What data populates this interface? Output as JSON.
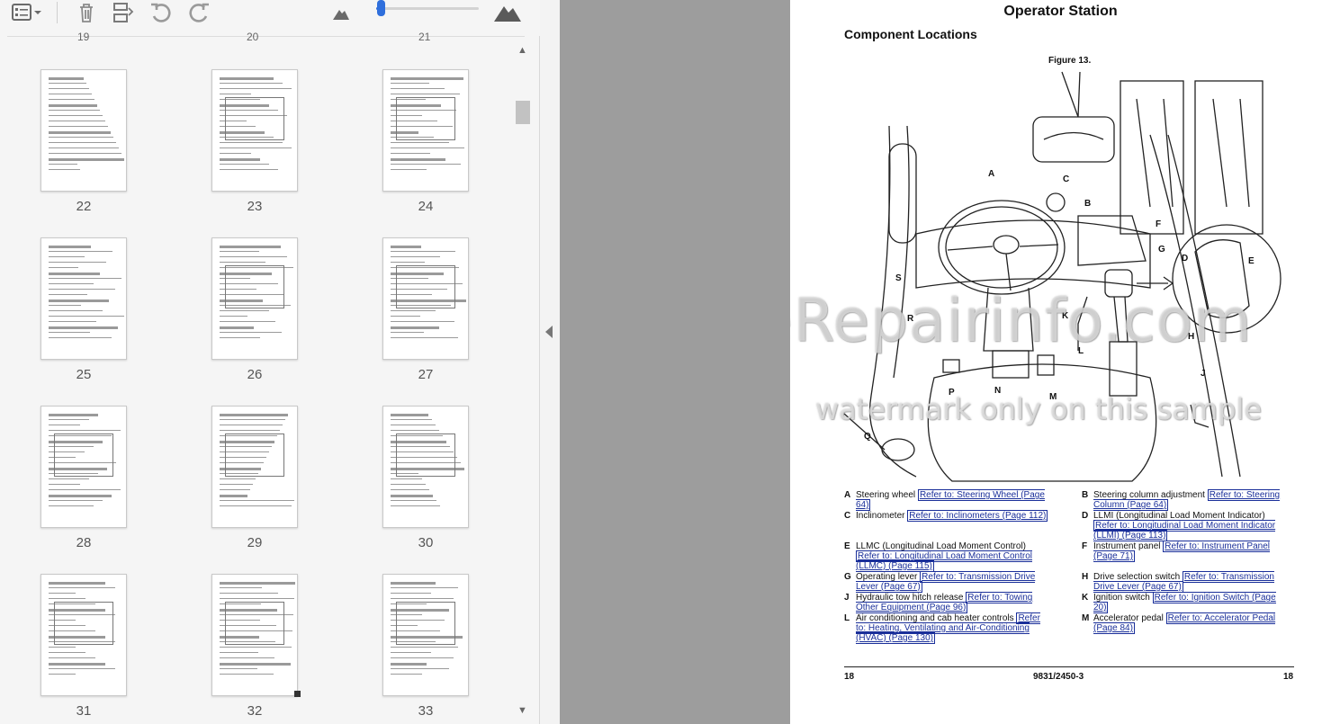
{
  "toolbar": {
    "buttons": [
      "thumbnail-view-menu",
      "delete",
      "replace-page",
      "rotate-counterclockwise",
      "rotate-clockwise",
      "zoom-out-thumbnails",
      "zoom-in-thumbnails"
    ],
    "zoom_level": 0.04,
    "accent_color": "#2f6fdc"
  },
  "thumbnails": {
    "partial_row_labels": [
      "19",
      "20",
      "21"
    ],
    "pages": [
      "22",
      "23",
      "24",
      "25",
      "26",
      "27",
      "28",
      "29",
      "30",
      "31",
      "32",
      "33"
    ]
  },
  "page": {
    "heading": "Operator Station",
    "subheading": "Component Locations",
    "figure_label": "Figure 13.",
    "callouts": [
      "A",
      "B",
      "C",
      "D",
      "E",
      "F",
      "G",
      "H",
      "J",
      "K",
      "L",
      "M",
      "N",
      "P",
      "Q",
      "R",
      "S"
    ],
    "legend": [
      {
        "key": "A",
        "text": "Steering wheel ",
        "link": "Refer to: Steering Wheel (Page 64)"
      },
      {
        "key": "B",
        "text": "Steering column adjustment ",
        "link": "Refer to: Steering Column (Page 64)"
      },
      {
        "key": "C",
        "text": "Inclinometer ",
        "link": "Refer to: Inclinometers (Page 112)"
      },
      {
        "key": "D",
        "text": "LLMI (Longitudinal Load Moment Indicator) ",
        "link": "Refer to: Longitudinal Load Moment Indicator (LLMI) (Page 113)"
      },
      {
        "key": "E",
        "text": "LLMC (Longitudinal Load Moment Control) ",
        "link": "Refer to: Longitudinal Load Moment Control (LLMC) (Page 115)"
      },
      {
        "key": "F",
        "text": "Instrument panel ",
        "link": "Refer to: Instrument Panel (Page 71)"
      },
      {
        "key": "G",
        "text": "Operating lever ",
        "link": "Refer to: Transmission Drive Lever (Page 67)"
      },
      {
        "key": "H",
        "text": "Drive selection switch ",
        "link": "Refer to: Transmission Drive Lever (Page 67)"
      },
      {
        "key": "J",
        "text": "Hydraulic tow hitch release ",
        "link": "Refer to: Towing Other Equipment (Page 96)"
      },
      {
        "key": "K",
        "text": "Ignition switch ",
        "link": "Refer to: Ignition Switch (Page 20)"
      },
      {
        "key": "L",
        "text": "Air conditioning and cab heater controls ",
        "link": "Refer to: Heating, Ventilating and Air-Conditioning (HVAC) (Page 130)"
      },
      {
        "key": "M",
        "text": "Accelerator pedal ",
        "link": "Refer to: Accelerator Pedal (Page 84)"
      }
    ],
    "footer_left": "18",
    "footer_center": "9831/2450-3",
    "footer_right": "18",
    "watermark_1": "eRepairinfo.com",
    "watermark_2": "watermark only on this sample"
  }
}
